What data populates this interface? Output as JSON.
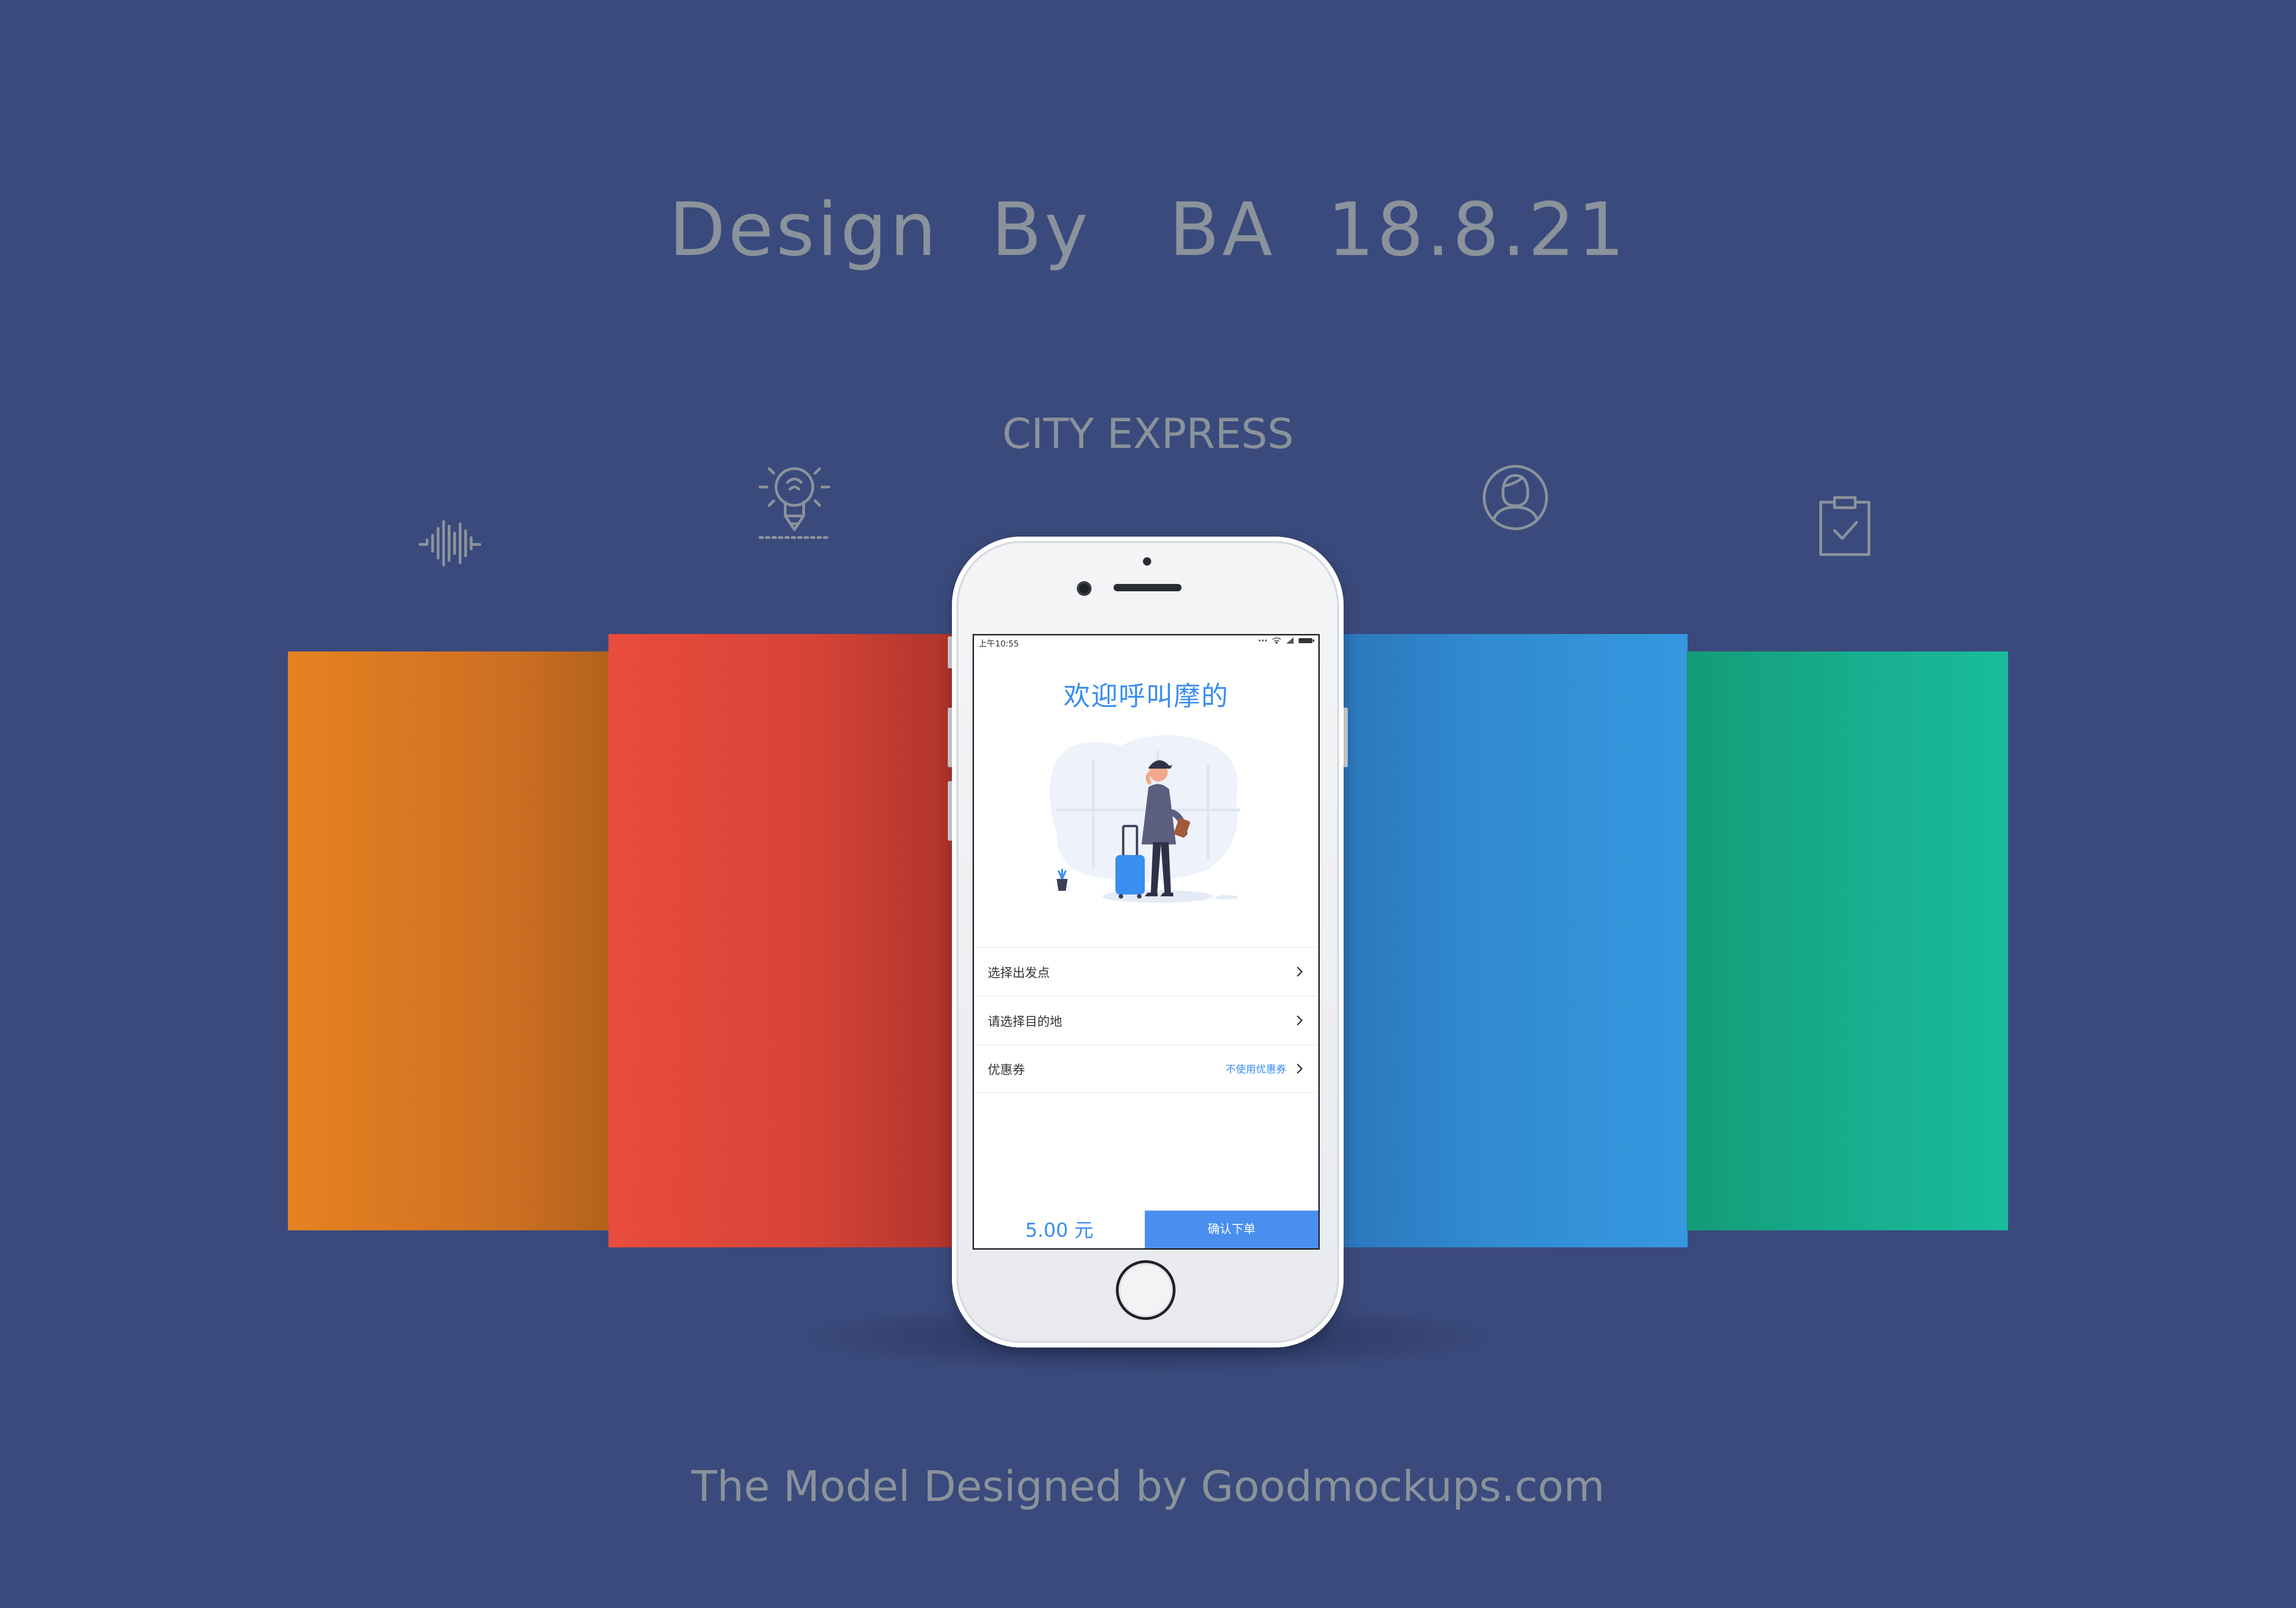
{
  "header": {
    "title": "Design  By   BA  18.8.21",
    "subtitle": "CITY EXPRESS"
  },
  "footer": {
    "credit": "The Model Designed by Goodmockups.com"
  },
  "decor_icons": [
    "soundwave-icon",
    "lightbulb-pencil-icon",
    "user-circle-icon",
    "clipboard-check-icon"
  ],
  "colors": {
    "background": "#3a4a7c",
    "panel_orange": "#e68221",
    "panel_red": "#e84c3d",
    "panel_blue": "#3698df",
    "panel_green": "#19bc9c",
    "accent_blue": "#3a8ef0",
    "text_gray": "#8a929b"
  },
  "app": {
    "status_bar": {
      "time": "上午10:55",
      "icons": [
        "signal-dots-icon",
        "wifi-icon",
        "cellular-icon",
        "battery-icon"
      ]
    },
    "welcome": "欢迎呼叫摩的",
    "illustration": "traveler-with-suitcase",
    "rows": [
      {
        "label": "选择出发点",
        "value": "",
        "icon": "chevron-right-icon"
      },
      {
        "label": "请选择目的地",
        "value": "",
        "icon": "chevron-right-icon"
      },
      {
        "label": "优惠券",
        "value": "不使用优惠券",
        "icon": "chevron-right-icon"
      }
    ],
    "price": "5.00 元",
    "confirm_label": "确认下单"
  }
}
